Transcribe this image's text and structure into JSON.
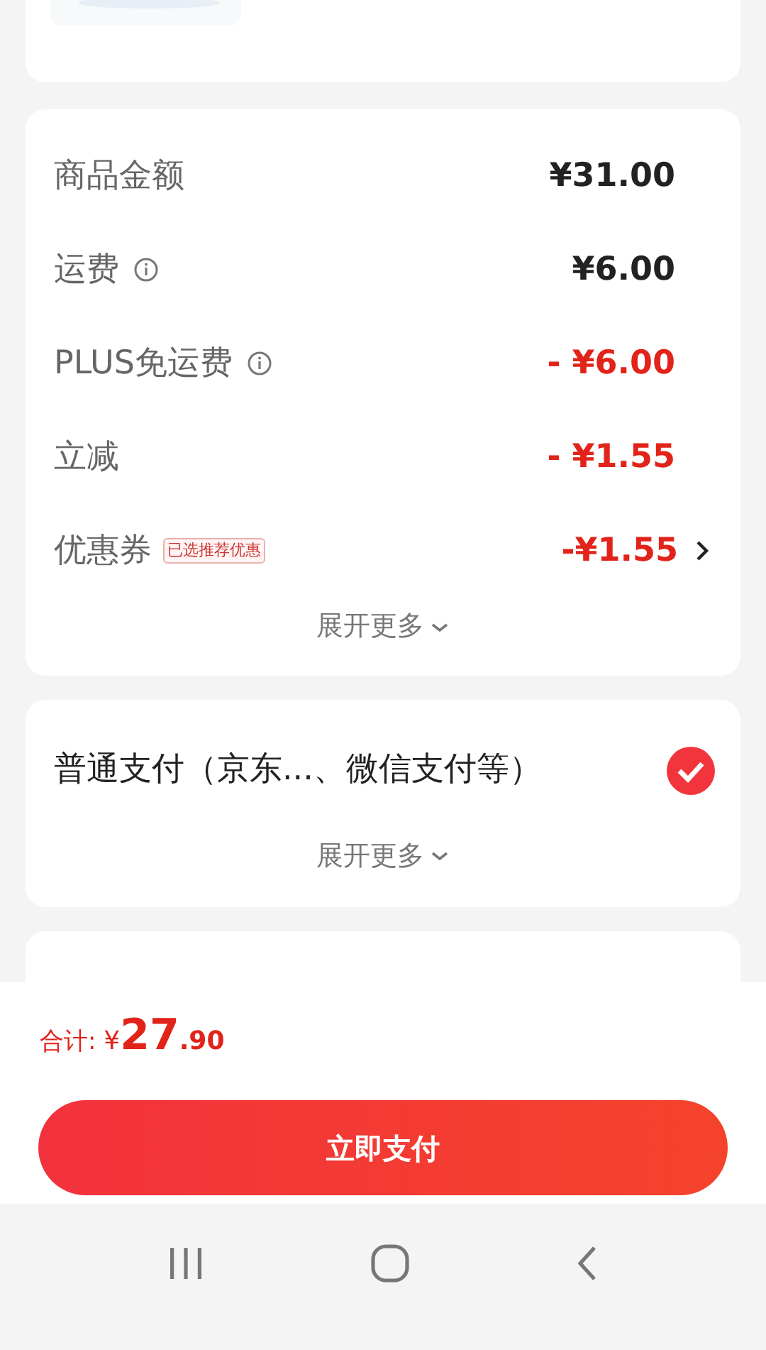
{
  "amounts": [
    {
      "label": "商品金额",
      "info": false,
      "value": "¥31.00",
      "kind": "plain",
      "chevron": false
    },
    {
      "label": "运费",
      "info": true,
      "value": "¥6.00",
      "kind": "plain",
      "chevron": false
    },
    {
      "label": "PLUS免运费",
      "info": true,
      "value": "- ¥6.00",
      "kind": "discount",
      "chevron": false
    },
    {
      "label": "立减",
      "info": false,
      "value": "- ¥1.55",
      "kind": "discount",
      "chevron": false
    },
    {
      "label": "优惠券",
      "info": false,
      "tag": "已选推荐优惠",
      "value": "-¥1.55",
      "kind": "discount",
      "chevron": true
    }
  ],
  "amounts_more": "展开更多",
  "payment": {
    "label": "普通支付（京东...、微信支付等）",
    "selected": true,
    "more": "展开更多"
  },
  "total": {
    "label": "合计:",
    "currency": "¥",
    "integer": "27",
    "decimal": ".90"
  },
  "pay_button": "立即支付"
}
